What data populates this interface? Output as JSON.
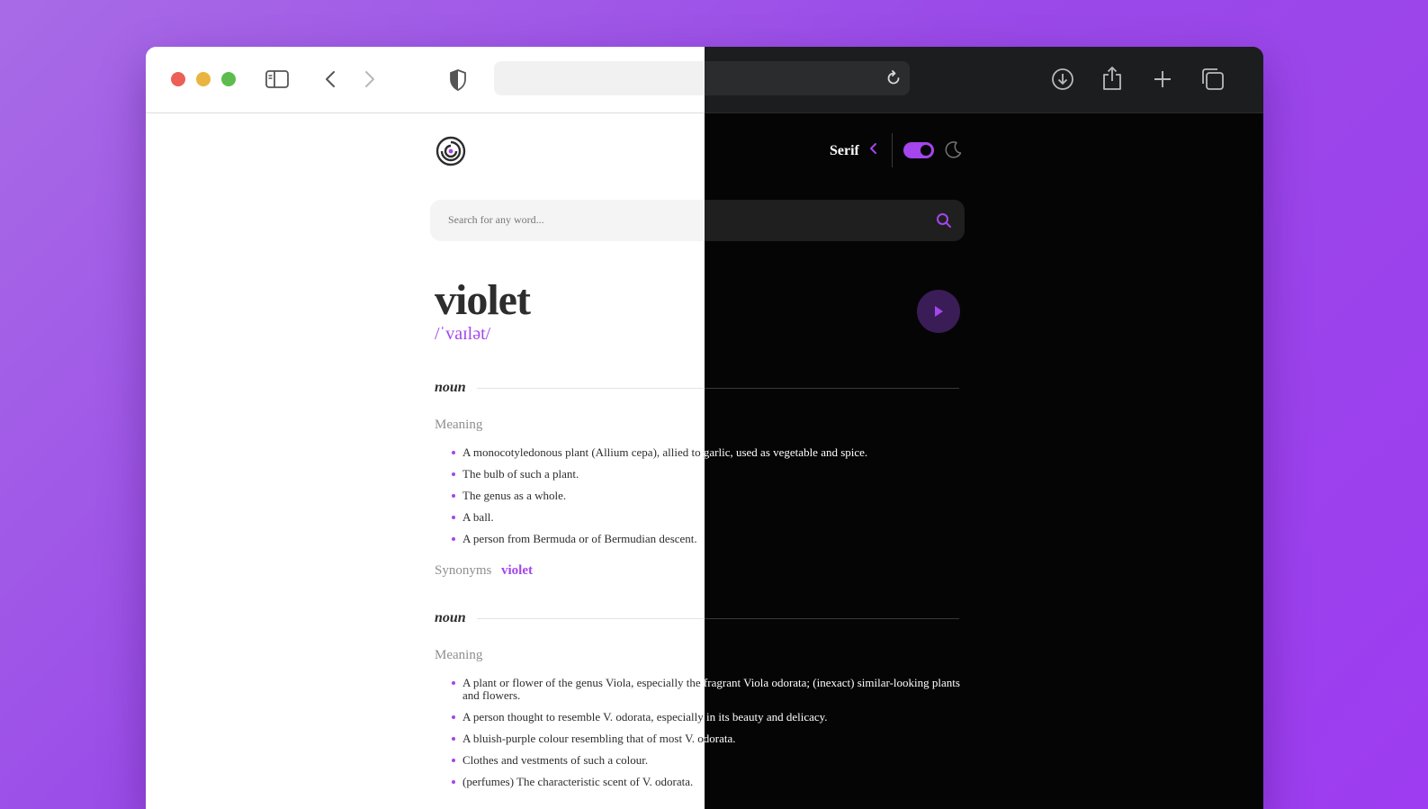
{
  "browser": {
    "address_text": "",
    "icons": [
      "sidebar-icon",
      "back-icon",
      "forward-icon",
      "shield-icon",
      "reload-icon",
      "download-icon",
      "share-icon",
      "new-tab-icon",
      "tabs-overview-icon"
    ]
  },
  "header": {
    "font_label": "Serif",
    "theme_toggle": "on"
  },
  "search": {
    "placeholder": "Search for any word..."
  },
  "entry": {
    "word": "violet",
    "phonetic": "/ˈvaɪlət/",
    "meanings": [
      {
        "part_of_speech": "noun",
        "meaning_label": "Meaning",
        "definitions": [
          "A monocotyledonous plant (Allium cepa), allied to garlic, used as vegetable and spice.",
          "The bulb of such a plant.",
          "The genus as a whole.",
          "A ball.",
          "A person from Bermuda or of Bermudian descent."
        ],
        "synonyms_label": "Synonyms",
        "synonyms": [
          "violet"
        ]
      },
      {
        "part_of_speech": "noun",
        "meaning_label": "Meaning",
        "definitions": [
          "A plant or flower of the genus Viola, especially the fragrant Viola odorata; (inexact) similar-looking plants and flowers.",
          "A person thought to resemble V. odorata, especially in its beauty and delicacy.",
          "A bluish-purple colour resembling that of most V. odorata.",
          "Clothes and vestments of such a colour.",
          "(perfumes) The characteristic scent of V. odorata."
        ]
      }
    ]
  },
  "colors": {
    "accent": "#a445ed",
    "background_gradient": [
      "#a86be6",
      "#9d3cf0"
    ]
  }
}
